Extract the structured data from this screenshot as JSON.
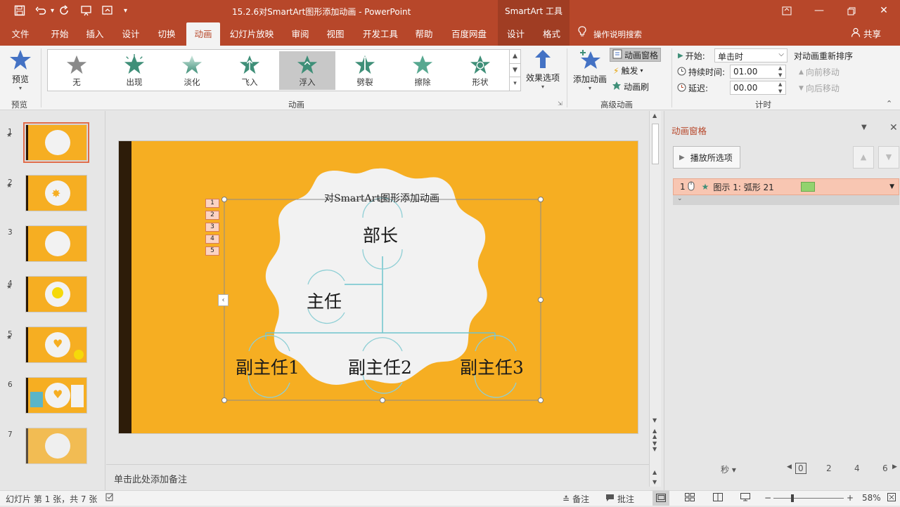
{
  "titlebar": {
    "doc_title": "15.2.6对SmartArt图形添加动画 - PowerPoint",
    "context_tools": "SmartArt 工具"
  },
  "tabs": [
    {
      "label": "文件"
    },
    {
      "label": "开始"
    },
    {
      "label": "插入"
    },
    {
      "label": "设计"
    },
    {
      "label": "切换"
    },
    {
      "label": "动画"
    },
    {
      "label": "幻灯片放映"
    },
    {
      "label": "审阅"
    },
    {
      "label": "视图"
    },
    {
      "label": "开发工具"
    },
    {
      "label": "帮助"
    },
    {
      "label": "百度网盘"
    },
    {
      "label": "设计"
    },
    {
      "label": "格式"
    }
  ],
  "search_hint": "操作说明搜索",
  "share_label": "共享",
  "ribbon": {
    "preview": {
      "button": "预览",
      "group": "预览"
    },
    "animation_group": "动画",
    "animations": [
      {
        "label": "无",
        "color": "#8a8a8a"
      },
      {
        "label": "出现",
        "color": "#3f8f78"
      },
      {
        "label": "淡化",
        "color": "#7fbfae"
      },
      {
        "label": "飞入",
        "color": "#3f8f78"
      },
      {
        "label": "浮入",
        "color": "#3f8f78"
      },
      {
        "label": "劈裂",
        "color": "#3f8f78"
      },
      {
        "label": "擦除",
        "color": "#57a890"
      },
      {
        "label": "形状",
        "color": "#3f8f78"
      }
    ],
    "effect_options": "效果选项",
    "advanced": {
      "group": "高级动画",
      "add_animation": "添加动画",
      "animation_pane": "动画窗格",
      "trigger": "触发",
      "animation_painter": "动画刷"
    },
    "timing": {
      "group": "计时",
      "start_label": "开始:",
      "start_value": "单击时",
      "duration_label": "持续时间:",
      "duration_value": "01.00",
      "delay_label": "延迟:",
      "delay_value": "00.00",
      "reorder_title": "对动画重新排序",
      "move_earlier": "向前移动",
      "move_later": "向后移动"
    }
  },
  "thumbnails": [
    {
      "num": "1",
      "starred": true
    },
    {
      "num": "2",
      "starred": true
    },
    {
      "num": "3",
      "starred": false
    },
    {
      "num": "4",
      "starred": true
    },
    {
      "num": "5",
      "starred": true
    },
    {
      "num": "6",
      "starred": false
    },
    {
      "num": "7",
      "starred": false
    }
  ],
  "slide": {
    "title": "对SmartArt图形添加动画",
    "nodes": {
      "head": "部长",
      "director": "主任",
      "deputy1": "副主任1",
      "deputy2": "副主任2",
      "deputy3": "副主任3"
    },
    "anim_tags": [
      "1",
      "2",
      "3",
      "4",
      "5"
    ]
  },
  "notes_placeholder": "单击此处添加备注",
  "animation_pane": {
    "title": "动画窗格",
    "play_button": "播放所选项",
    "items": [
      {
        "index": "1",
        "label": "图示 1: 弧形 21",
        "bar_color": "#92d36e"
      }
    ],
    "time_unit": "秒",
    "ruler": [
      "0",
      "2",
      "4",
      "6"
    ]
  },
  "statusbar": {
    "slide_info": "幻灯片 第 1 张，共 7 张",
    "notes": "备注",
    "comments": "批注",
    "zoom": "58%"
  }
}
